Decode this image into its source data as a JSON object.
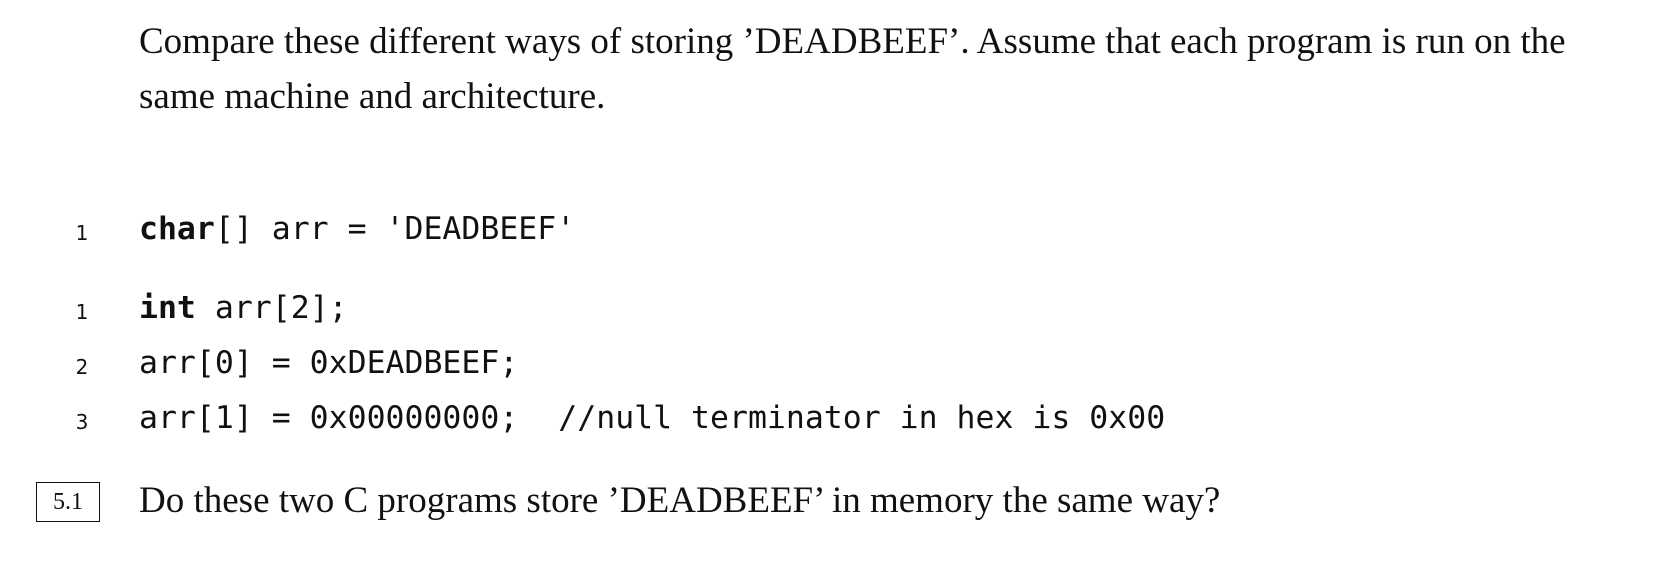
{
  "intro": {
    "text": "Compare these different ways of storing ’DEADBEEF’. Assume that each program is run on the same machine and architecture."
  },
  "program1": {
    "lines": [
      {
        "number": "1",
        "keyword": "char",
        "rest": "[] arr = 'DEADBEEF'",
        "comment": ""
      }
    ]
  },
  "program2": {
    "lines": [
      {
        "number": "1",
        "keyword": "int",
        "rest": " arr[2];",
        "comment": ""
      },
      {
        "number": "2",
        "keyword": "",
        "rest": "arr[0] = 0xDEADBEEF;",
        "comment": ""
      },
      {
        "number": "3",
        "keyword": "",
        "rest": "arr[1] = 0x00000000;",
        "comment": "//null terminator in hex is 0x00"
      }
    ]
  },
  "question": {
    "number": "5.1",
    "text": "Do these two C programs store ’DEADBEEF’ in memory the same way?"
  }
}
